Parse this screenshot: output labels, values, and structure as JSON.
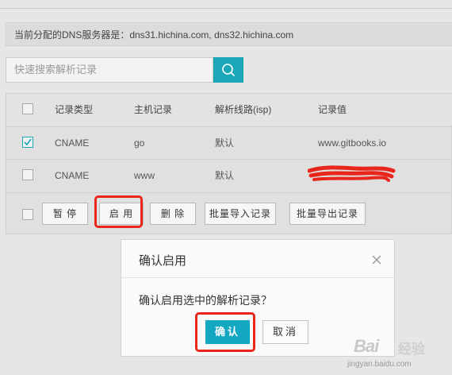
{
  "dns_info": "当前分配的DNS服务器是：dns31.hichina.com, dns32.hichina.com",
  "search": {
    "placeholder": "快速搜索解析记录"
  },
  "table": {
    "headers": {
      "type": "记录类型",
      "host": "主机记录",
      "line": "解析线路(isp)",
      "value": "记录值"
    },
    "rows": [
      {
        "checked": true,
        "type": "CNAME",
        "host": "go",
        "line": "默认",
        "value": "www.gitbooks.io"
      },
      {
        "checked": false,
        "type": "CNAME",
        "host": "www",
        "line": "默认",
        "value": ""
      }
    ]
  },
  "actions": {
    "pause": "暂 停",
    "enable": "启 用",
    "delete": "删 除",
    "import": "批量导入记录",
    "export": "批量导出记录"
  },
  "modal": {
    "title": "确认启用",
    "message": "确认启用选中的解析记录？",
    "confirm": "确认",
    "cancel": "取消"
  },
  "watermark": {
    "logo": "Bai",
    "brand": "经验",
    "url": "jingyan.baidu.com"
  },
  "colors": {
    "accent": "#1aa8b8",
    "highlight": "#e8261b"
  }
}
